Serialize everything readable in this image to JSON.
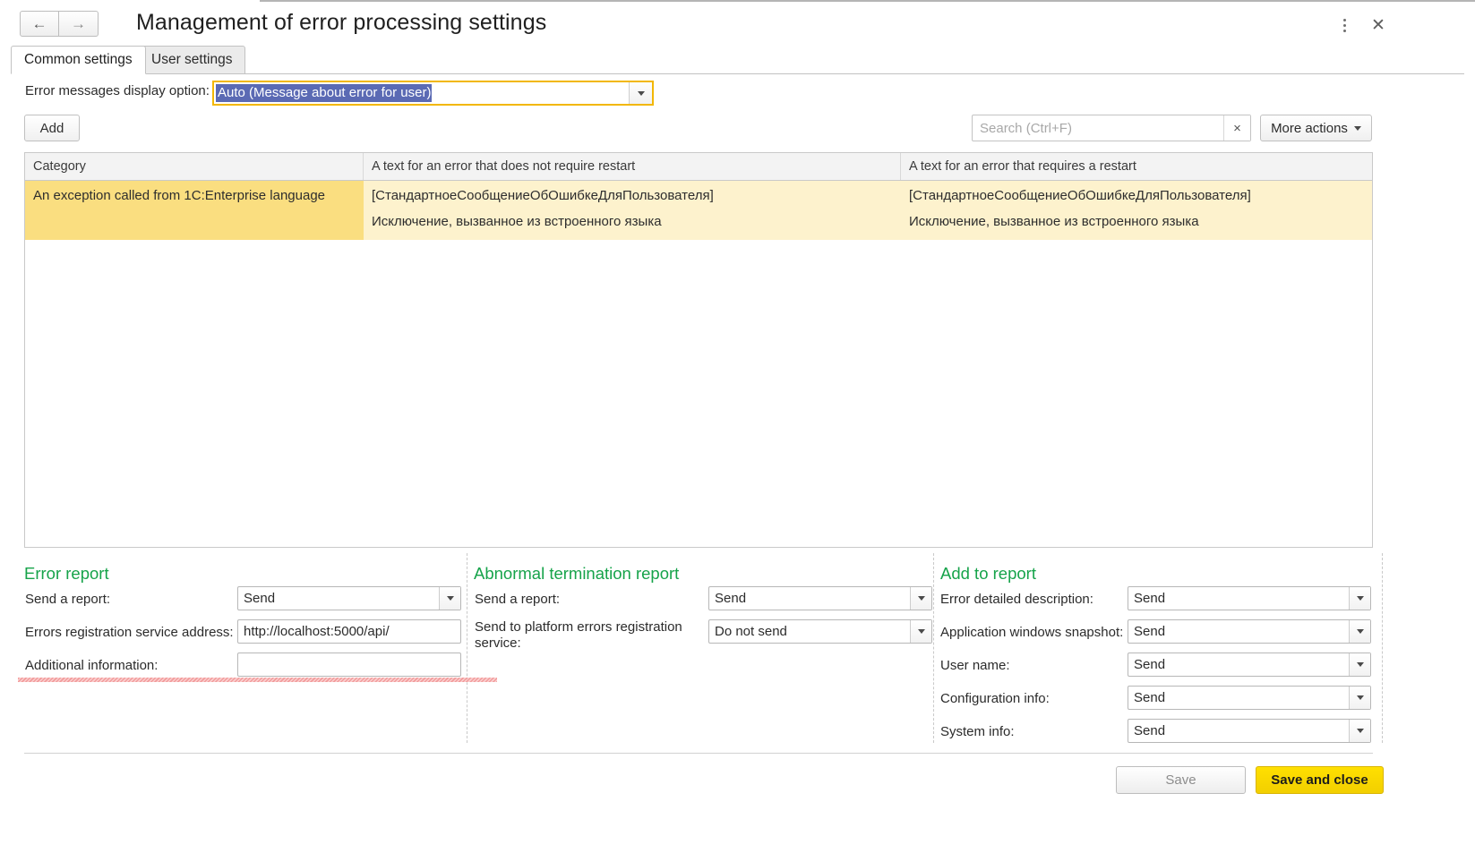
{
  "window": {
    "title": "Management of error processing settings",
    "nav_back": "←",
    "nav_forward": "→",
    "menu_icon": "kebab-menu-icon",
    "close_label": "✕"
  },
  "tabs": [
    {
      "label": "Common settings",
      "active": true
    },
    {
      "label": "User settings",
      "active": false
    }
  ],
  "option_row": {
    "label": "Error messages display option:",
    "value": "Auto (Message about error for user)"
  },
  "toolbar": {
    "add_label": "Add",
    "search_value": "",
    "search_placeholder": "Search (Ctrl+F)",
    "search_clear": "×",
    "more_actions_label": "More actions"
  },
  "table": {
    "columns": [
      "Category",
      "A text for an error that does not require restart",
      "A text for an error that requires a restart"
    ],
    "rows": [
      {
        "category": "An exception called from 1C:Enterprise language",
        "no_restart_line1": "[СтандартноеСообщениеОбОшибкеДляПользователя]",
        "no_restart_line2": "Исключение, вызванное из встроенного языка",
        "restart_line1": "[СтандартноеСообщениеОбОшибкеДляПользователя]",
        "restart_line2": "Исключение, вызванное из встроенного языка"
      }
    ]
  },
  "error_report": {
    "title": "Error report",
    "send_report_label": "Send a report:",
    "send_report_value": "Send",
    "service_address_label": "Errors registration service address:",
    "service_address_value": "http://localhost:5000/api/",
    "additional_info_label": "Additional information:",
    "additional_info_value": ""
  },
  "abnormal_report": {
    "title": "Abnormal termination report",
    "send_report_label": "Send a report:",
    "send_report_value": "Send",
    "platform_service_label": "Send to platform errors registration service:",
    "platform_service_value": "Do not send"
  },
  "add_to_report": {
    "title": "Add to report",
    "fields": [
      {
        "label": "Error detailed description:",
        "value": "Send"
      },
      {
        "label": "Application windows snapshot:",
        "value": "Send"
      },
      {
        "label": "User name:",
        "value": "Send"
      },
      {
        "label": "Configuration info:",
        "value": "Send"
      },
      {
        "label": "System info:",
        "value": "Send"
      }
    ]
  },
  "footer": {
    "save_label": "Save",
    "save_and_close_label": "Save and close"
  },
  "colors": {
    "accent_yellow": "#ffe000",
    "focus_border": "#f2b705",
    "group_title_green": "#16a34a",
    "row_selected": "#fade80",
    "row_background": "#fdf2cd",
    "selection_blue": "#5b6ab4",
    "spellcheck_pink": "#f08b8b"
  }
}
